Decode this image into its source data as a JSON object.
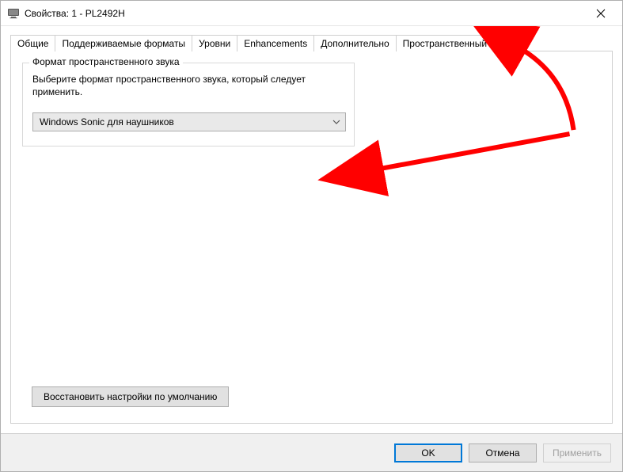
{
  "window": {
    "title": "Свойства: 1 - PL2492H"
  },
  "tabs": [
    {
      "label": "Общие"
    },
    {
      "label": "Поддерживаемые форматы"
    },
    {
      "label": "Уровни"
    },
    {
      "label": "Enhancements"
    },
    {
      "label": "Дополнительно"
    },
    {
      "label": "Пространственный звук"
    }
  ],
  "spatial": {
    "group_title": "Формат пространственного звука",
    "hint": "Выберите формат пространственного звука, который следует применить.",
    "selected": "Windows Sonic для наушников"
  },
  "restore_defaults": "Восстановить настройки по умолчанию",
  "footer": {
    "ok": "OK",
    "cancel": "Отмена",
    "apply": "Применить"
  }
}
